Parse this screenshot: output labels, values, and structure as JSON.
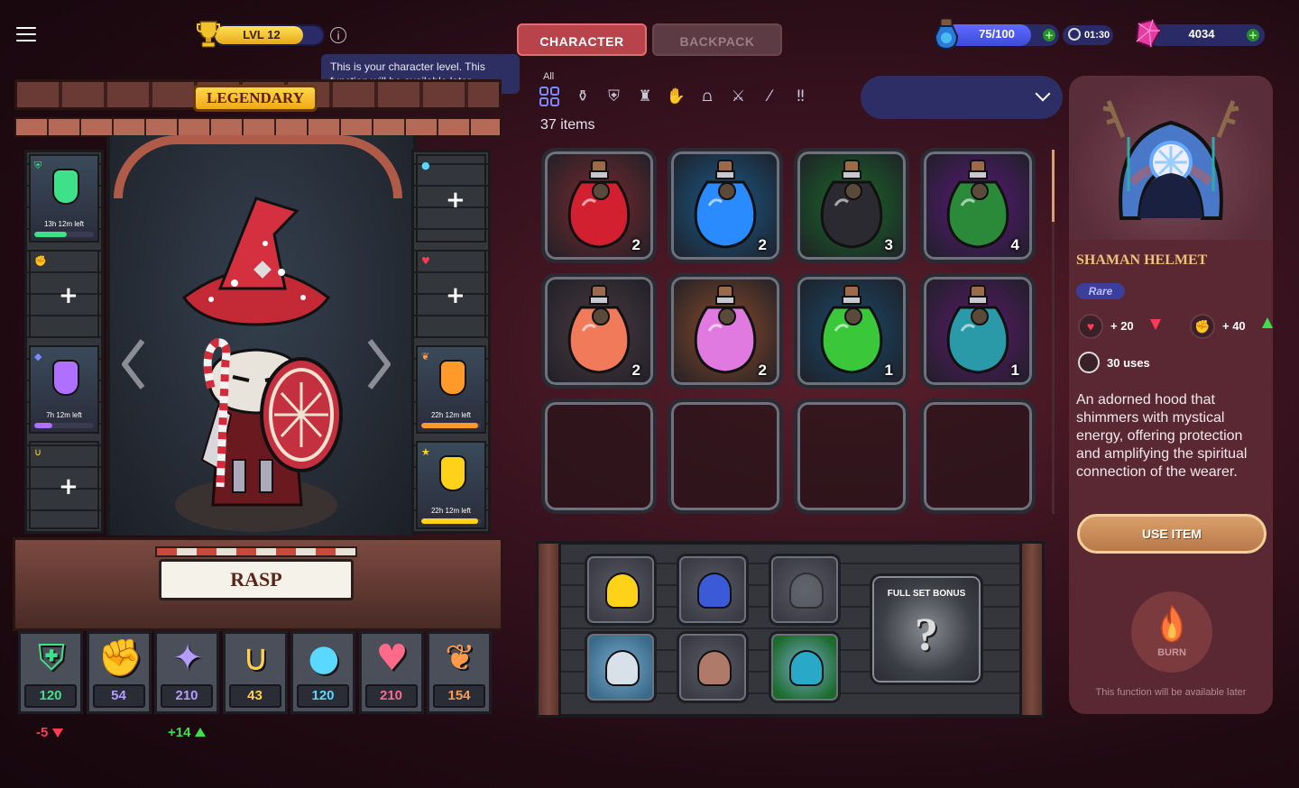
{
  "header": {
    "level_label": "LVL 12",
    "level_progress": 0.82,
    "info_tooltip": "This is your character level. This function will be available later.",
    "tabs": [
      {
        "label": "CHARACTER",
        "active": true
      },
      {
        "label": "BACKPACK",
        "active": false
      }
    ],
    "energy": {
      "value": "75/100",
      "fraction": 0.75
    },
    "timer": "01:30",
    "gems": "4034"
  },
  "character": {
    "rarity": "LEGENDARY",
    "name": "RASP",
    "left_slots": [
      {
        "icon": "shield-icon",
        "timer": "13h 12m left",
        "progress": 0.55,
        "color": "#3ee08a",
        "empty": false
      },
      {
        "icon": "fist-icon",
        "empty": true
      },
      {
        "icon": "crystal-icon",
        "timer": "7h 12m left",
        "progress": 0.3,
        "color": "#b070ff",
        "empty": false
      },
      {
        "icon": "horseshoe-icon",
        "empty": true
      }
    ],
    "right_slots": [
      {
        "icon": "lightbulb-icon",
        "empty": true
      },
      {
        "icon": "heart-icon",
        "empty": true
      },
      {
        "icon": "wing-icon",
        "timer": "22h 12m left",
        "progress": 0.95,
        "color": "#ff9a2a",
        "empty": false
      },
      {
        "icon": "star-icon",
        "timer": "22h 12m left",
        "progress": 0.95,
        "color": "#ffd21a",
        "empty": false
      }
    ],
    "stats": [
      {
        "name": "defense",
        "value": "120",
        "color": "#3ee08a"
      },
      {
        "name": "strength",
        "value": "54",
        "color": "#b59cff"
      },
      {
        "name": "magic",
        "value": "210",
        "color": "#b59cff"
      },
      {
        "name": "luck",
        "value": "43",
        "color": "#ffd24a"
      },
      {
        "name": "intellect",
        "value": "120",
        "color": "#5ad8ff"
      },
      {
        "name": "health",
        "value": "210",
        "color": "#ff6a8a"
      },
      {
        "name": "agility",
        "value": "154",
        "color": "#ff9a4a"
      }
    ],
    "deltas": [
      {
        "value": "-5",
        "direction": "down",
        "color": "#ff3a55"
      },
      {
        "value": "+14",
        "direction": "up",
        "color": "#3ee04a"
      }
    ]
  },
  "inventory": {
    "filter_all_label": "All",
    "filters": [
      "potion-icon",
      "shield-badge-icon",
      "armor-icon",
      "gloves-icon",
      "boots-icon",
      "sword-icon",
      "wand-icon",
      "double-exclamation-icon"
    ],
    "items_count": "37 items",
    "items": [
      {
        "name": "heart-potion",
        "count": "2",
        "bg": "#7a2a30",
        "liquid": "#d22030"
      },
      {
        "name": "blue-potion",
        "count": "2",
        "bg": "#1a5a8a",
        "liquid": "#2a8aff"
      },
      {
        "name": "fist-potion",
        "count": "3",
        "bg": "#1a6a2a",
        "liquid": "#2a2a30"
      },
      {
        "name": "shield-potion",
        "count": "4",
        "bg": "#5a1a7a",
        "liquid": "#2a8a3a"
      },
      {
        "name": "wing-potion",
        "count": "2",
        "bg": "#4a3a40",
        "liquid": "#f07a5a"
      },
      {
        "name": "rainbow-potion",
        "count": "2",
        "bg": "#8a4a2a",
        "liquid": "#e07ae0"
      },
      {
        "name": "leaf-potion",
        "count": "1",
        "bg": "#1a4a6a",
        "liquid": "#3ac83a"
      },
      {
        "name": "totem-potion",
        "count": "1",
        "bg": "#5a1a6a",
        "liquid": "#2a9aa8"
      }
    ],
    "empty_slots": 4
  },
  "set": {
    "bonus_title": "FULL SET BONUS",
    "bonus_symbol": "?",
    "pieces": [
      {
        "name": "golden-helmet",
        "owned": true,
        "bg": "#3a3b44",
        "color": "#ffd21a"
      },
      {
        "name": "blue-armor",
        "owned": true,
        "bg": "#3a3b44",
        "color": "#3a5ad8"
      },
      {
        "name": "gloves",
        "owned": false,
        "bg": "#3a3b44",
        "color": "#6a6c74"
      },
      {
        "name": "silver-staff",
        "owned": true,
        "bg": "#3a6a8a",
        "color": "#d8e0ea"
      },
      {
        "name": "round-shield",
        "owned": true,
        "bg": "#3a3b44",
        "color": "#b07a6a"
      },
      {
        "name": "green-boots",
        "owned": true,
        "bg": "#1a6a2a",
        "color": "#2aa8c8"
      }
    ]
  },
  "detail": {
    "item_name": "SHAMAN HELMET",
    "rarity": "Rare",
    "stat1": {
      "value": "+ 20",
      "direction": "down"
    },
    "stat2": {
      "value": "+ 40",
      "direction": "up"
    },
    "uses": "30 uses",
    "description": "An adorned hood that shimmers with mystical energy, offering protection and amplifying the spiritual connection of the wearer.",
    "use_label": "USE ITEM",
    "burn_label": "BURN",
    "later_note": "This function will be available later"
  }
}
